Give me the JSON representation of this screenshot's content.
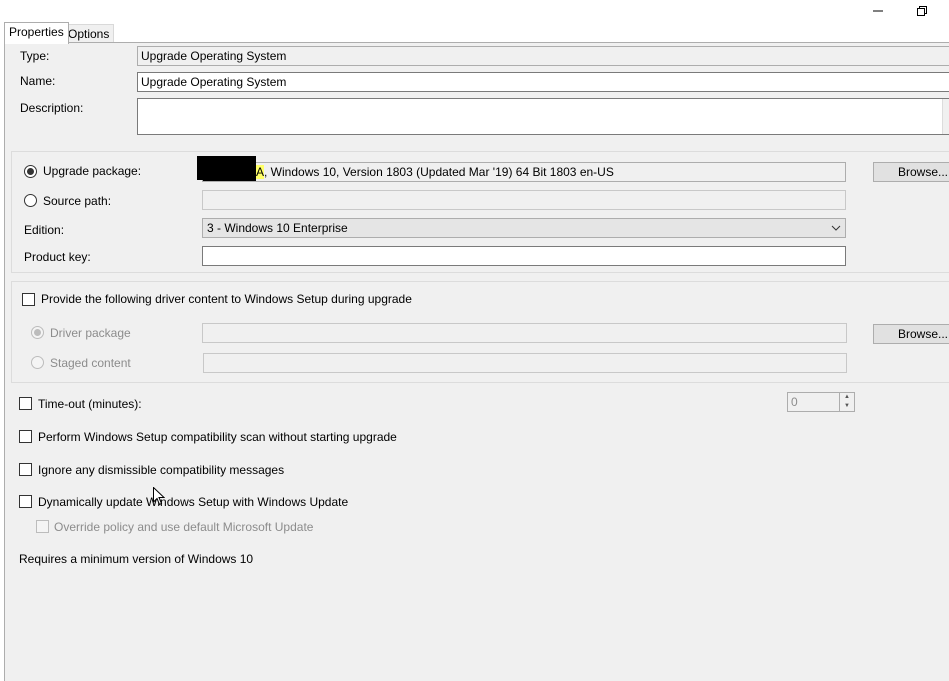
{
  "window": {
    "minimize_label": "─",
    "restore_label": "❐"
  },
  "tabs": [
    {
      "label": "Properties"
    },
    {
      "label": "Options"
    }
  ],
  "general": {
    "type_label": "Type:",
    "type_value": "Upgrade Operating System",
    "name_label": "Name:",
    "name_value": "Upgrade Operating System",
    "description_label": "Description:",
    "description_value": ""
  },
  "source": {
    "upgrade_package_label": "Upgrade package:",
    "upgrade_package_highlight": "A",
    "upgrade_package_value": ", Windows 10, Version 1803 (Updated Mar '19) 64 Bit 1803 en-US",
    "browse_label": "Browse...",
    "source_path_label": "Source path:",
    "source_path_value": "",
    "edition_label": "Edition:",
    "edition_value": "3 - Windows 10 Enterprise",
    "product_key_label": "Product key:",
    "product_key_value": ""
  },
  "drivers": {
    "provide_label": "Provide the following driver content to Windows Setup during upgrade",
    "driver_package_label": "Driver package",
    "staged_content_label": "Staged content",
    "browse_label": "Browse..."
  },
  "options": {
    "timeout_label": "Time-out (minutes):",
    "timeout_value": "0",
    "compat_scan_label": "Perform Windows Setup compatibility scan without starting upgrade",
    "ignore_messages_label": "Ignore any dismissible compatibility messages",
    "dynamic_update_label": "Dynamically update Windows Setup with Windows Update",
    "override_policy_label": "Override policy and use default Microsoft Update"
  },
  "footer": {
    "requirement_text": "Requires a minimum version of Windows 10"
  }
}
